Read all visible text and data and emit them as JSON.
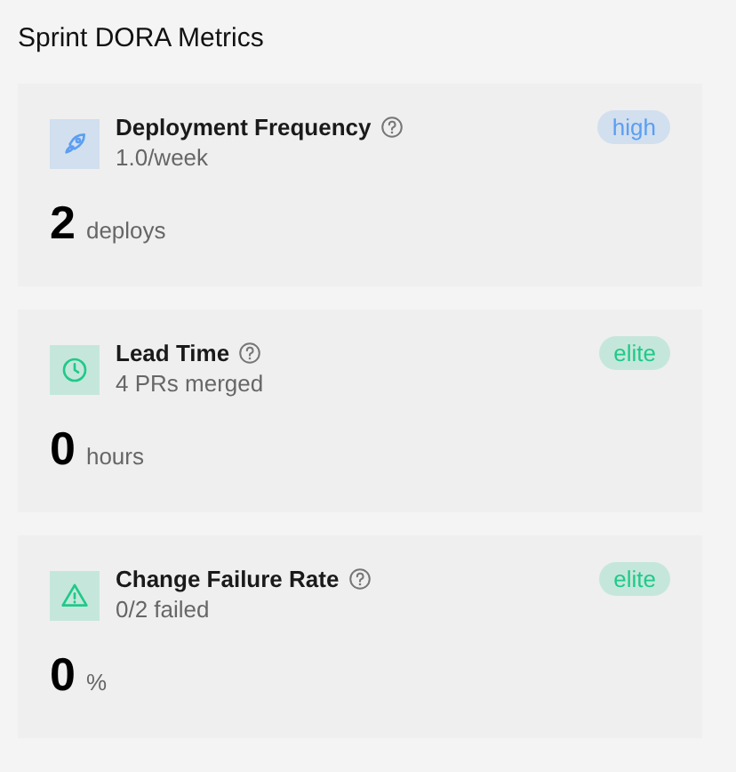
{
  "title": "Sprint DORA Metrics",
  "metrics": [
    {
      "kind": "rocket",
      "name": "Deployment Frequency",
      "subtitle": "1.0/week",
      "rating": "high",
      "color": "#5b9ef2",
      "value": "2",
      "unit": "deploys"
    },
    {
      "kind": "clock",
      "name": "Lead Time",
      "subtitle": "4 PRs merged",
      "rating": "elite",
      "color": "#20c98a",
      "value": "0",
      "unit": "hours"
    },
    {
      "kind": "warning",
      "name": "Change Failure Rate",
      "subtitle": "0/2 failed",
      "rating": "elite",
      "color": "#20c98a",
      "value": "0",
      "unit": "%"
    }
  ]
}
